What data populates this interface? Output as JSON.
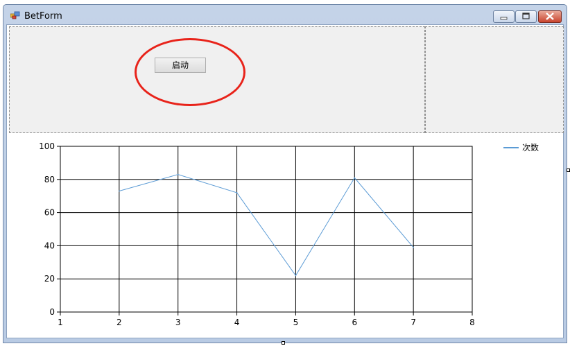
{
  "window": {
    "title": "BetForm"
  },
  "controls": {
    "start_label": "启动"
  },
  "chart_data": {
    "type": "line",
    "x": [
      2,
      3,
      4,
      5,
      6,
      7
    ],
    "series": [
      {
        "name": "次数",
        "values": [
          73,
          83,
          72,
          22,
          81,
          39
        ],
        "color": "#5b9bd5"
      }
    ],
    "xlim": [
      1,
      8
    ],
    "ylim": [
      0,
      100
    ],
    "xticks": [
      1,
      2,
      3,
      4,
      5,
      6,
      7,
      8
    ],
    "yticks": [
      0,
      20,
      40,
      60,
      80,
      100
    ],
    "grid": true,
    "legend": "top-right"
  }
}
